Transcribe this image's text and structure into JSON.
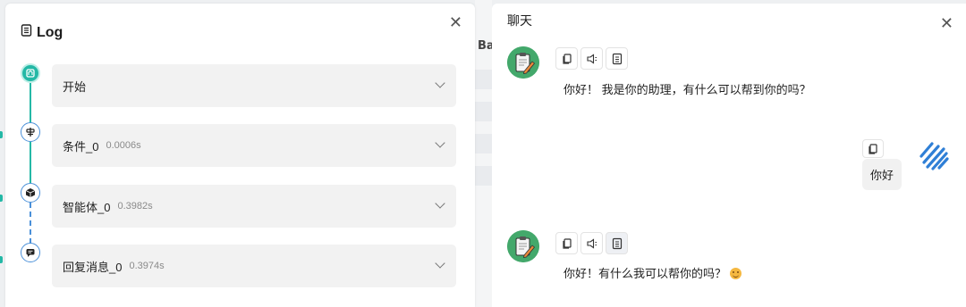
{
  "background": {
    "fragment_text": "Ba"
  },
  "log": {
    "icon": "document-list-icon",
    "title": "Log",
    "close_icon": "close-icon",
    "steps": [
      {
        "icon": "home-flow-icon",
        "name": "开始",
        "time": ""
      },
      {
        "icon": "branch-condition-icon",
        "name": "条件_0",
        "time": "0.0006s"
      },
      {
        "icon": "cube-agent-icon",
        "name": "智能体_0",
        "time": "0.3982s"
      },
      {
        "icon": "reply-message-icon",
        "name": "回复消息_0",
        "time": "0.3974s"
      }
    ],
    "accent_color": "#24b8a6",
    "line_color": "#4a90d9"
  },
  "chat": {
    "title": "聊天",
    "close_icon": "close-icon",
    "messages": [
      {
        "role": "bot",
        "avatar": "notepad-pencil-avatar",
        "text": "你好！ 我是你的助理，有什么可以帮到你的吗？",
        "tools": [
          "copy-icon",
          "speaker-icon",
          "document-icon"
        ]
      },
      {
        "role": "user",
        "avatar": "stripes-logo-avatar",
        "text": "你好",
        "tools": [
          "copy-icon"
        ]
      },
      {
        "role": "bot",
        "avatar": "notepad-pencil-avatar",
        "text": "你好！有什么我可以帮你的吗？",
        "emoji": "smiling-face-emoji",
        "tools": [
          "copy-icon",
          "speaker-icon",
          "document-icon"
        ]
      }
    ]
  }
}
